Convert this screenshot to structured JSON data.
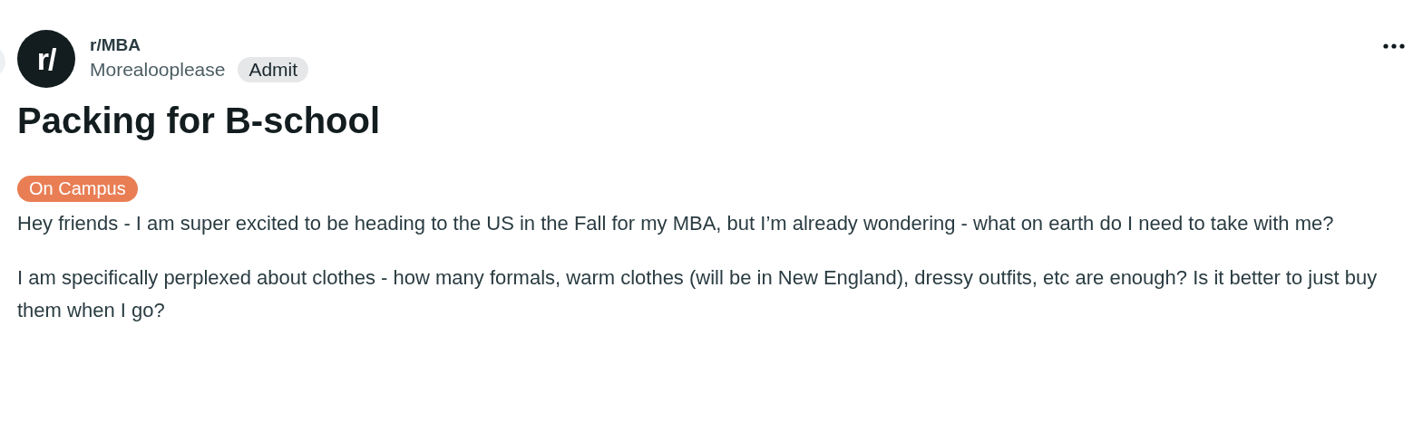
{
  "post": {
    "subreddit": "r/MBA",
    "avatar_text": "r/",
    "author": "Morealooplease",
    "user_flair": "Admit",
    "title": "Packing for B-school",
    "post_flair": {
      "label": "On Campus",
      "color": "#e97e55"
    },
    "paragraphs": [
      "Hey friends - I am super excited to be heading to the US in the Fall for my MBA, but I’m already wondering - what on earth do I need to take with me?",
      "I am specifically perplexed about clothes - how many formals, warm clothes (will be in New England), dressy outfits, etc are enough? Is it better to just buy them when I go?"
    ]
  }
}
